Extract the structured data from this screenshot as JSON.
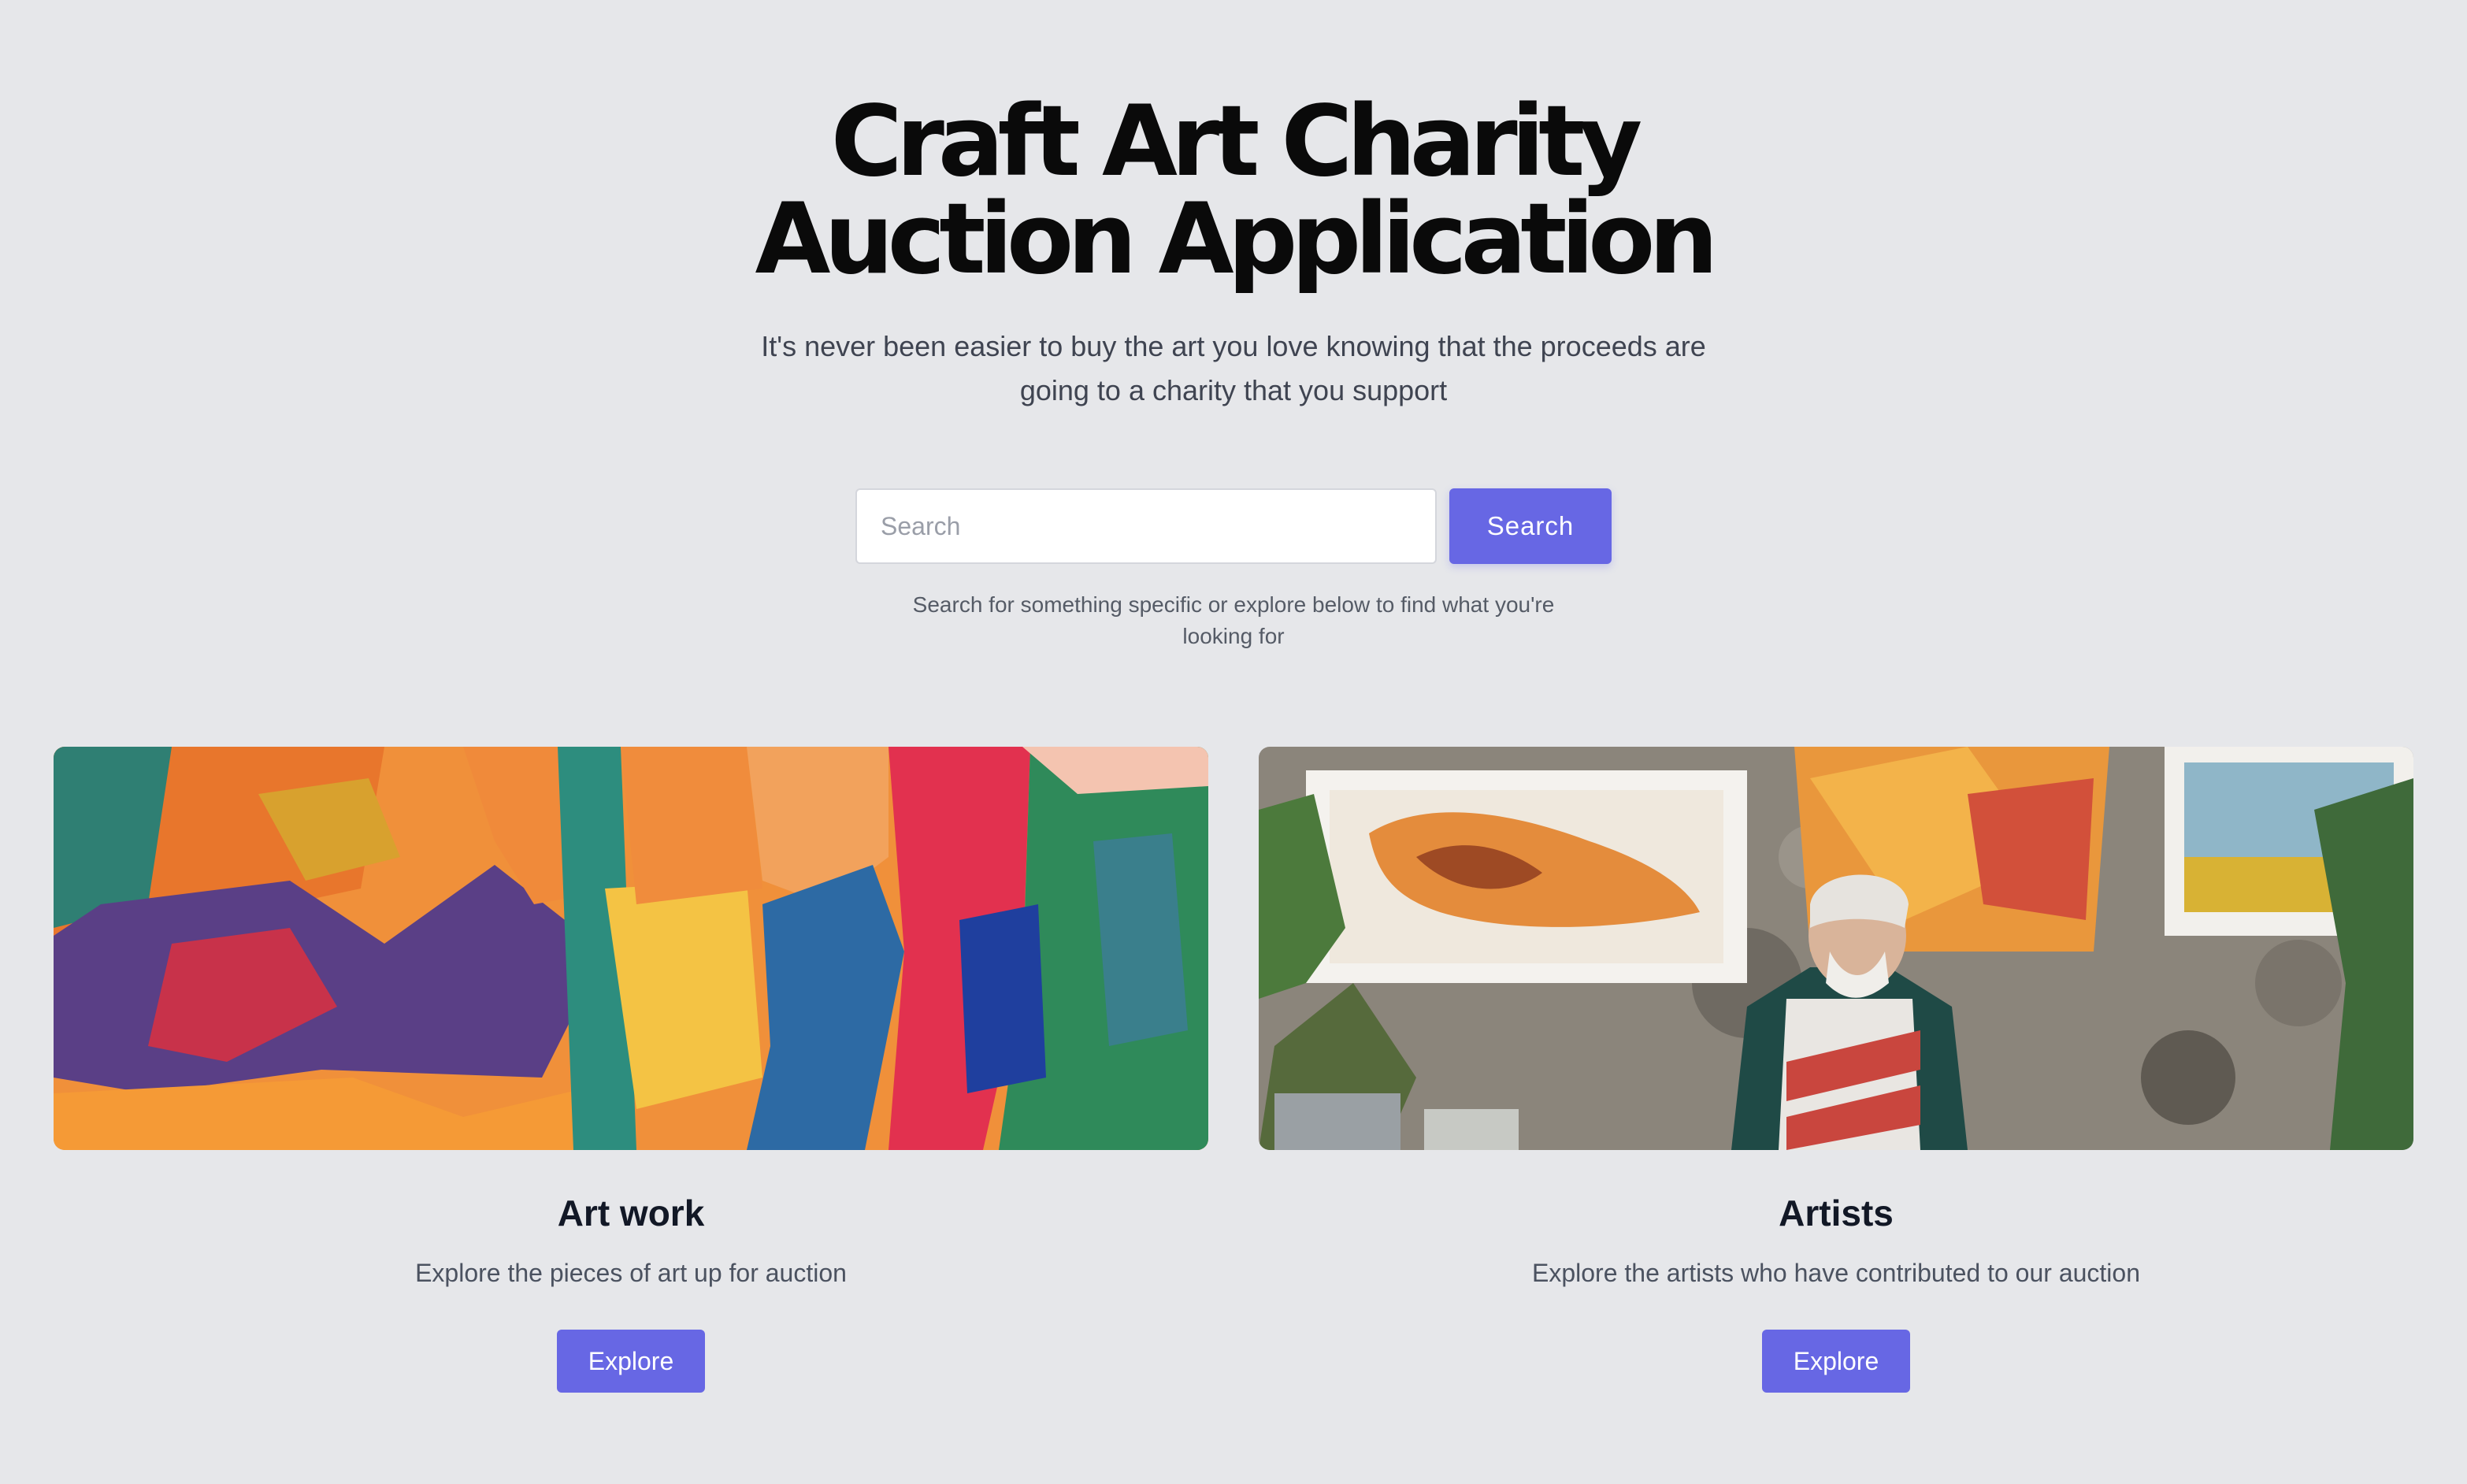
{
  "hero": {
    "title": "Craft Art Charity Auction Application",
    "subtitle": "It's never been easier to buy the art you love knowing that the proceeds are going to a charity that you support"
  },
  "search": {
    "placeholder": "Search",
    "button_label": "Search",
    "hint": "Search for something specific or explore below to find what you're looking for"
  },
  "cards": [
    {
      "title": "Art work",
      "description": "Explore the pieces of art up for auction",
      "button_label": "Explore",
      "image": "abstract-painting"
    },
    {
      "title": "Artists",
      "description": "Explore the artists who have contributed to our auction",
      "button_label": "Explore",
      "image": "artist-painting-photo"
    }
  ],
  "colors": {
    "background": "#e6e7ea",
    "accent": "#6767e4",
    "title": "#0a0a0a"
  }
}
